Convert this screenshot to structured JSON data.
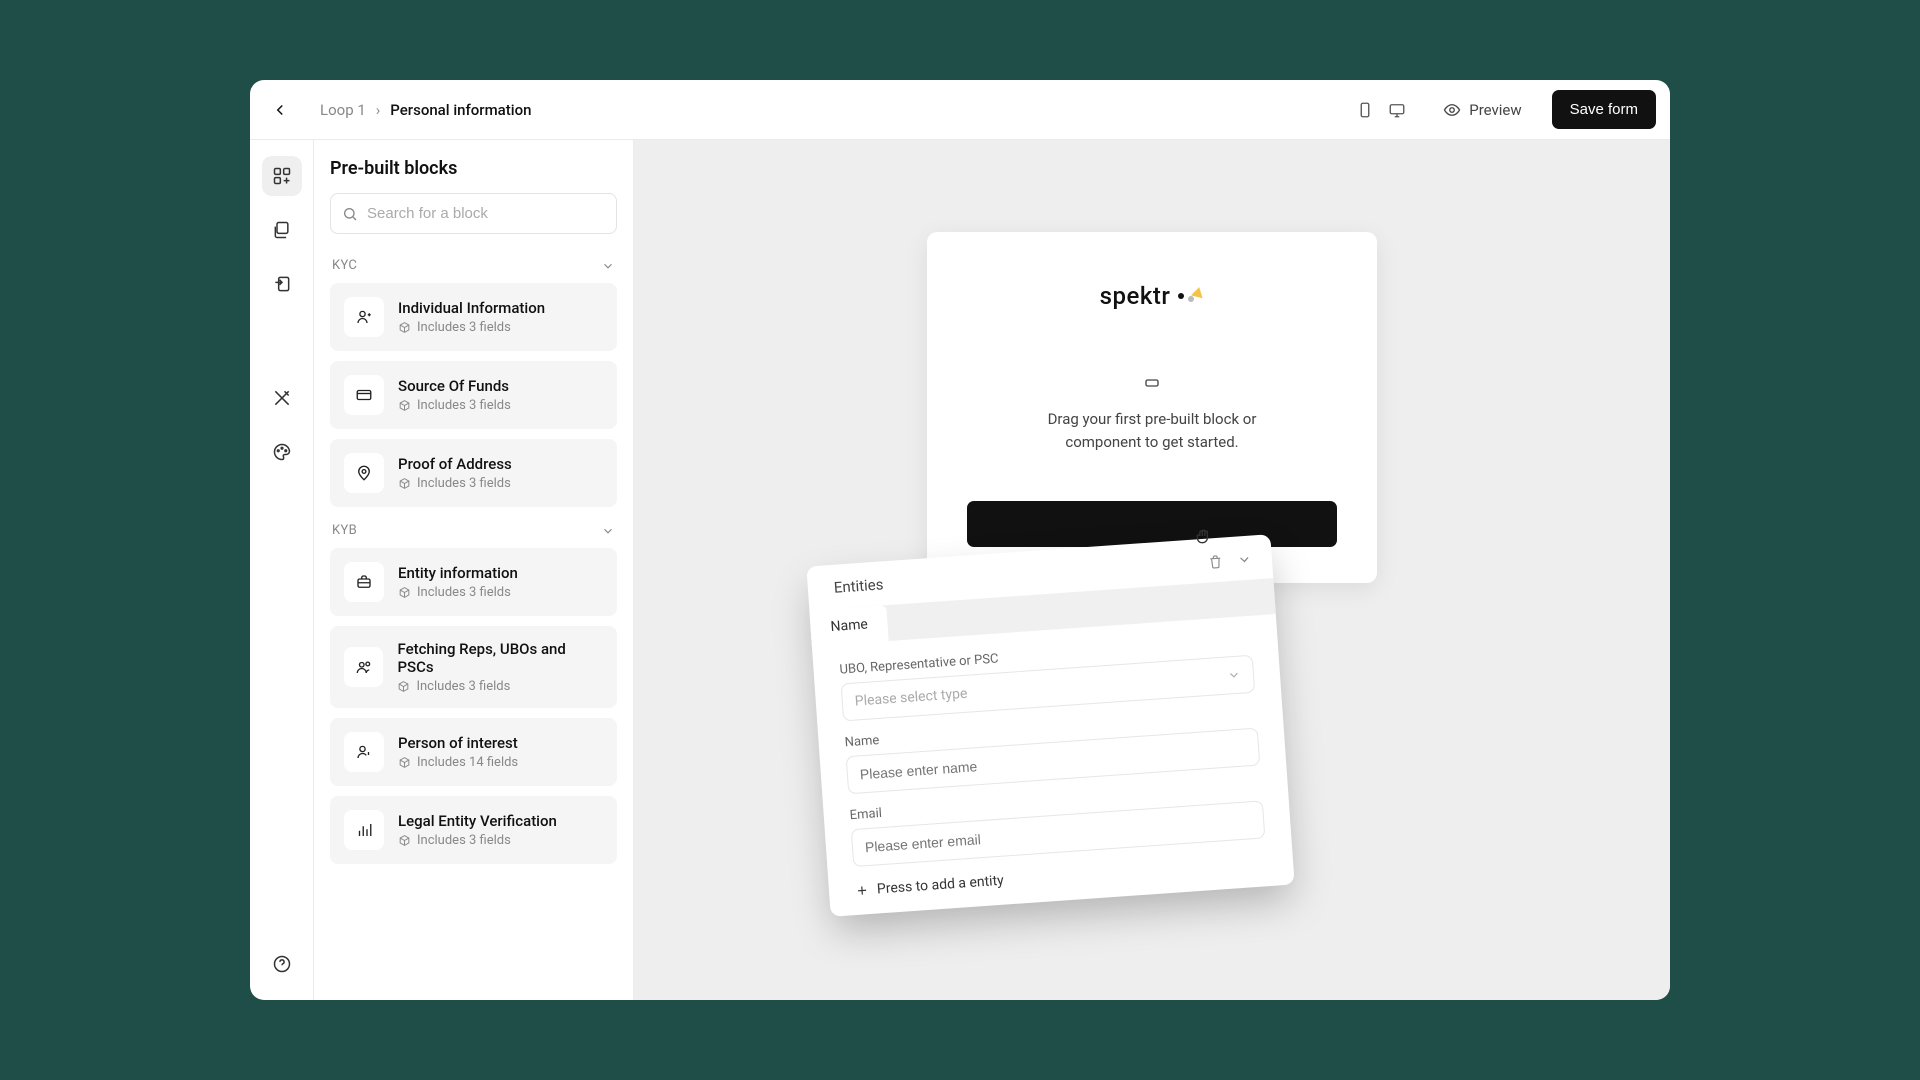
{
  "breadcrumb": {
    "parent": "Loop 1",
    "sep": "›",
    "current": "Personal information"
  },
  "header": {
    "preview": "Preview",
    "save": "Save form"
  },
  "sidepanel": {
    "title": "Pre-built blocks",
    "search_placeholder": "Search for a block",
    "sections": {
      "kyc": {
        "label": "KYC"
      },
      "kyb": {
        "label": "KYB"
      }
    },
    "blocks": {
      "individual": {
        "title": "Individual Information",
        "sub": "Includes 3 fields"
      },
      "sof": {
        "title": "Source Of Funds",
        "sub": "Includes 3 fields"
      },
      "poa": {
        "title": "Proof of Address",
        "sub": "Includes 3 fields"
      },
      "entity": {
        "title": "Entity information",
        "sub": "Includes 3 fields"
      },
      "reps": {
        "title": "Fetching Reps, UBOs and PSCs",
        "sub": "Includes 3 fields"
      },
      "poi": {
        "title": "Person of interest",
        "sub": "Includes 14 fields"
      },
      "lev": {
        "title": "Legal Entity Verification",
        "sub": "Includes 3 fields"
      }
    }
  },
  "form": {
    "brand": "spektr",
    "message_line1": "Drag your first pre-built block or",
    "message_line2": "component to get started."
  },
  "entities_card": {
    "title": "Entities",
    "tab": "Name",
    "field_type_label": "UBO, Representative or PSC",
    "field_type_placeholder": "Please select type",
    "name_label": "Name",
    "name_placeholder": "Please enter name",
    "email_label": "Email",
    "email_placeholder": "Please enter email",
    "add_label": "Press to add a entity"
  }
}
